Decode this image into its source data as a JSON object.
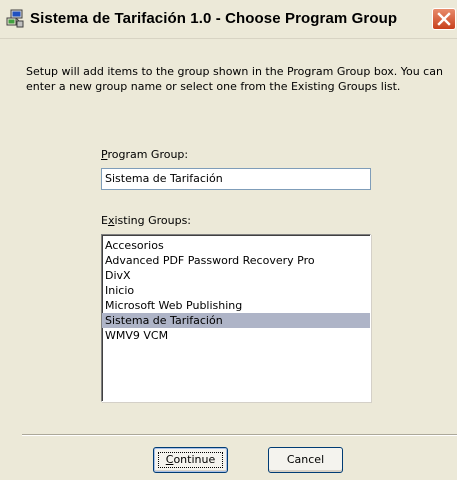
{
  "window": {
    "title": "Sistema de Tarifación 1.0 - Choose Program Group",
    "icon": "setup-computer-icon",
    "close_icon": "close-icon"
  },
  "intro_text": "Setup will add items to the group shown in the Program Group box. You can enter a new group name or select one from the Existing Groups list.",
  "program_group": {
    "label_mnemonic": "P",
    "label_rest": "rogram Group:",
    "value": "Sistema de Tarifación"
  },
  "existing_groups": {
    "label_first": "E",
    "label_mnemonic": "x",
    "label_rest": "isting Groups:",
    "items": [
      "Accesorios",
      "Advanced PDF Password Recovery Pro",
      "DivX",
      "Inicio",
      "Microsoft Web Publishing",
      "Sistema de Tarifación",
      "WMV9 VCM"
    ],
    "selected": "Sistema de Tarifación"
  },
  "buttons": {
    "continue_mnemonic": "C",
    "continue_rest": "ontinue",
    "cancel": "Cancel"
  }
}
